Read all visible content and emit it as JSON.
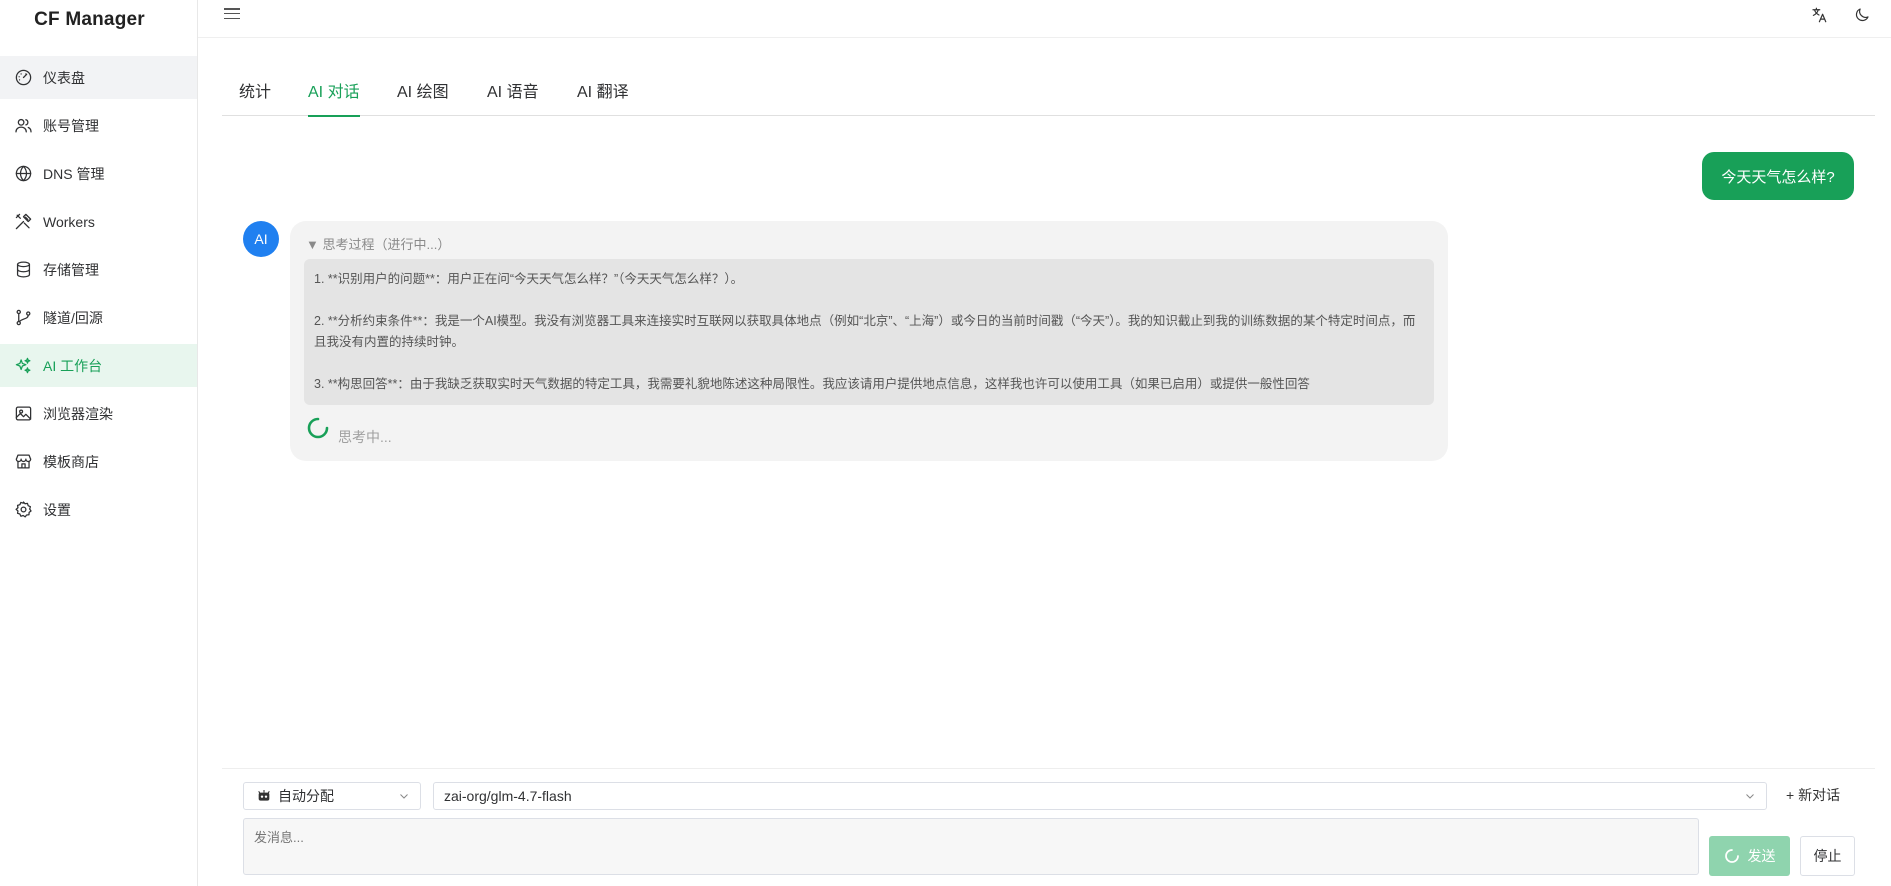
{
  "app": {
    "title": "CF Manager"
  },
  "sidebar": {
    "items": [
      {
        "label": "仪表盘",
        "icon": "dashboard-icon",
        "state": "hover"
      },
      {
        "label": "账号管理",
        "icon": "users-icon",
        "state": ""
      },
      {
        "label": "DNS 管理",
        "icon": "globe-icon",
        "state": ""
      },
      {
        "label": "Workers",
        "icon": "tools-icon",
        "state": ""
      },
      {
        "label": "存储管理",
        "icon": "database-icon",
        "state": ""
      },
      {
        "label": "隧道/回源",
        "icon": "git-branch-icon",
        "state": ""
      },
      {
        "label": "AI 工作台",
        "icon": "sparkles-icon",
        "state": "active"
      },
      {
        "label": "浏览器渲染",
        "icon": "image-icon",
        "state": ""
      },
      {
        "label": "模板商店",
        "icon": "store-icon",
        "state": ""
      },
      {
        "label": "设置",
        "icon": "gear-icon",
        "state": ""
      }
    ]
  },
  "tabs": [
    {
      "label": "统计",
      "active": false
    },
    {
      "label": "AI 对话",
      "active": true
    },
    {
      "label": "AI 绘图",
      "active": false
    },
    {
      "label": "AI 语音",
      "active": false
    },
    {
      "label": "AI 翻译",
      "active": false
    }
  ],
  "chat": {
    "user_message": "今天天气怎么样?",
    "ai_avatar": "AI",
    "think_header": "▼ 思考过程（进行中...）",
    "think_lines": [
      "1. **识别用户的问题**：用户正在问“今天天气怎么样？”（今天天气怎么样？）。",
      "2. **分析约束条件**：我是一个AI模型。我没有浏览器工具来连接实时互联网以获取具体地点（例如“北京”、“上海”）或今日的当前时间戳（“今天”）。我的知识截止到我的训练数据的某个特定时间点，而且我没有内置的持续时钟。",
      "3. **构思回答**：由于我缺乏获取实时天气数据的特定工具，我需要礼貌地陈述这种局限性。我应该请用户提供地点信息，这样我也许可以使用工具（如果已启用）或提供一般性回答"
    ],
    "thinking_label": "思考中..."
  },
  "composer": {
    "provider_select": "自动分配",
    "model_select": "zai-org/glm-4.7-flash",
    "new_chat_label": "+ 新对话",
    "input_placeholder": "发消息...",
    "send_label": "发送",
    "stop_label": "停止"
  },
  "colors": {
    "accent": "#18a058",
    "ai_avatar": "#2080f0",
    "send_disabled": "#8fd4ae"
  }
}
